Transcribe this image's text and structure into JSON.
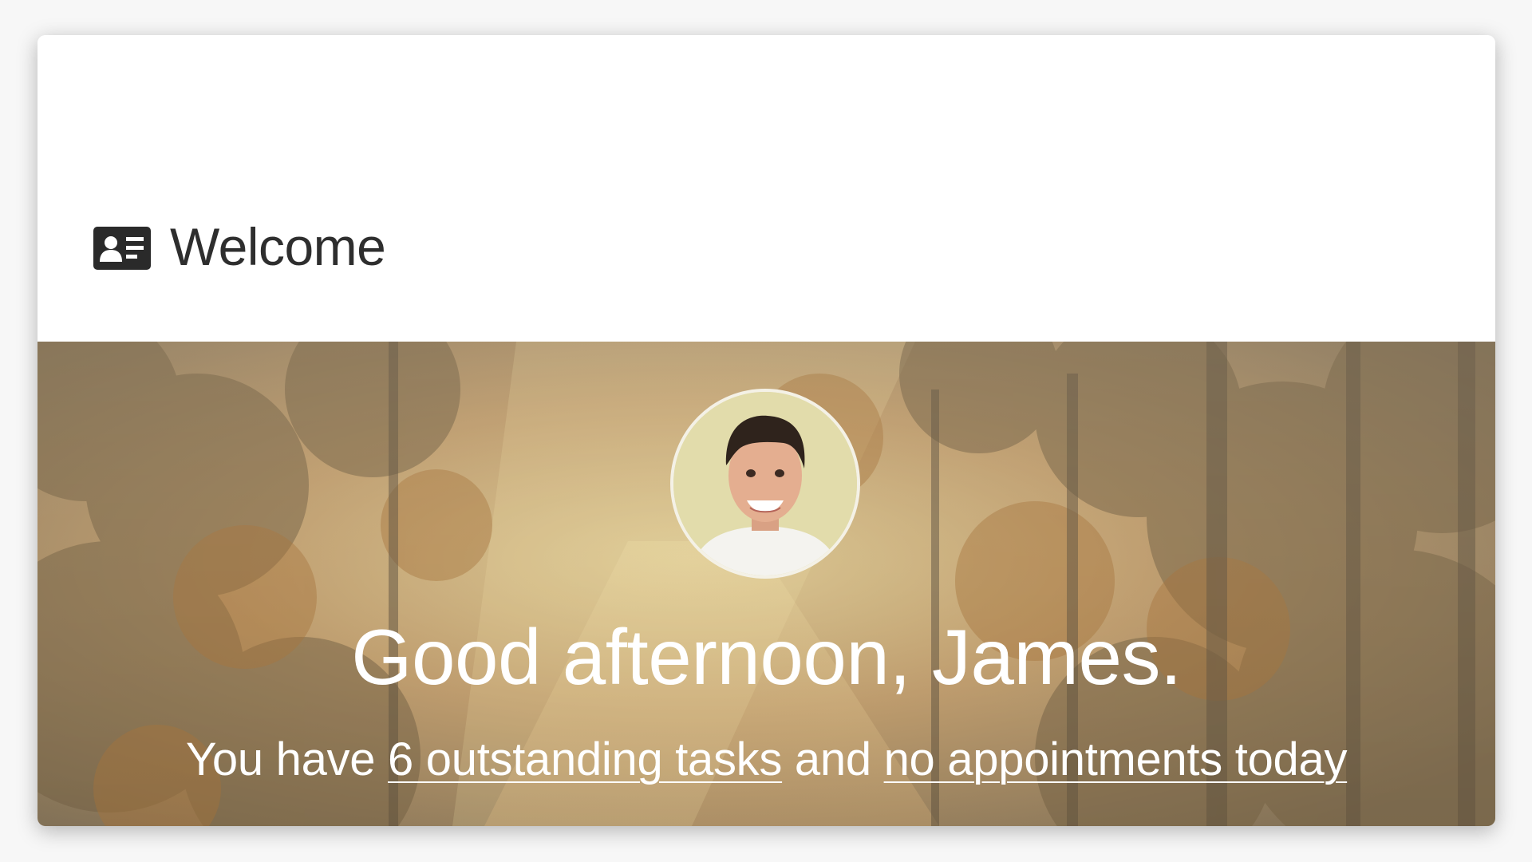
{
  "header": {
    "title": "Welcome",
    "icon": "contact-card-icon"
  },
  "hero": {
    "background": "autumn-forest-path",
    "avatar": "profile-photo",
    "greeting": "Good afternoon, James.",
    "summary": {
      "prefix": "You have ",
      "tasks_link": "6 outstanding tasks",
      "middle": " and ",
      "appointments_link": "no appointments today"
    }
  },
  "colors": {
    "card_background": "#ffffff",
    "header_text": "#2e2e2e",
    "hero_text": "#ffffff"
  }
}
